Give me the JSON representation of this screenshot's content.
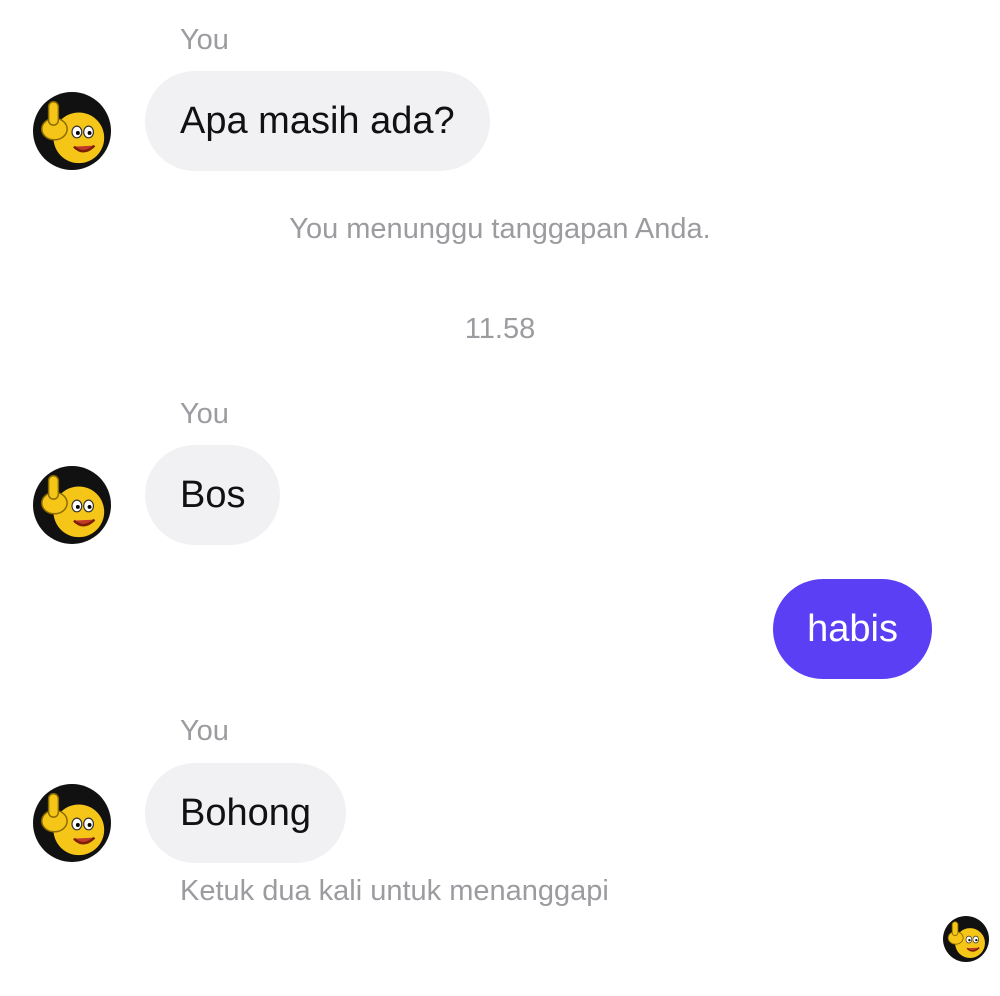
{
  "messages": [
    {
      "sender": "You",
      "text": "Apa masih ada?",
      "avatar_icon": "thumbs-up-smiley-icon"
    },
    {
      "sender": "You",
      "text": "Bos",
      "avatar_icon": "thumbs-up-smiley-icon"
    },
    {
      "text": "habis",
      "outgoing": true
    },
    {
      "sender": "You",
      "text": "Bohong",
      "avatar_icon": "thumbs-up-smiley-icon"
    }
  ],
  "notes": {
    "awaiting": "You menunggu tanggapan Anda.",
    "timestamp": "11.58",
    "double_tap_hint": "Ketuk dua kali untuk menanggapi"
  },
  "seen_avatar_icon": "thumbs-up-smiley-icon",
  "colors": {
    "incoming_bubble": "#f1f1f4",
    "outgoing_bubble": "#5b3ff5",
    "meta_text": "#9b9ba0"
  }
}
